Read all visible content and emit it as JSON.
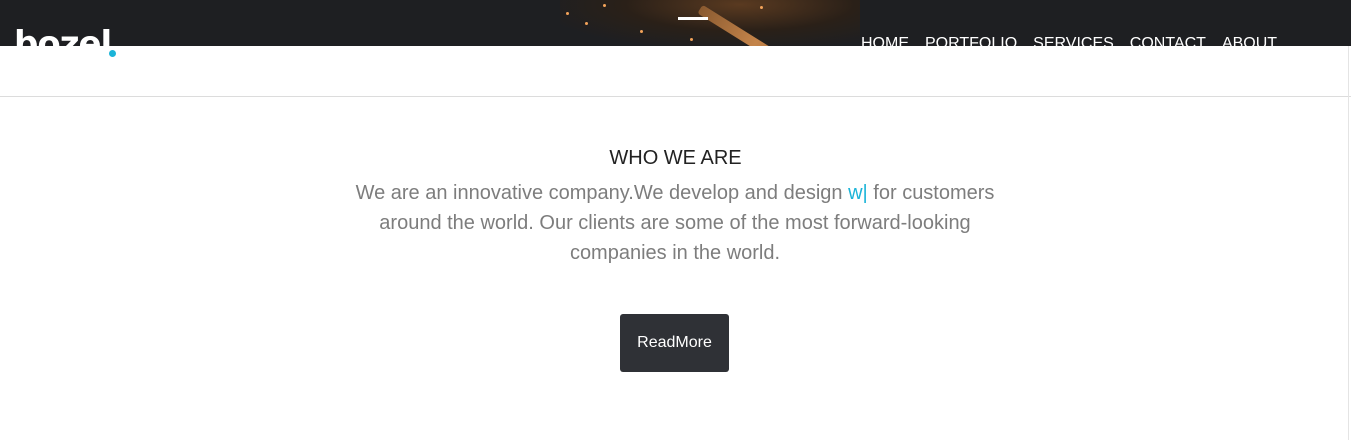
{
  "header": {
    "logo_text": "bozel",
    "nav": [
      {
        "label": "HOME"
      },
      {
        "label": "PORTFOLIO"
      },
      {
        "label": "SERVICES"
      },
      {
        "label": "CONTACT"
      },
      {
        "label": "ABOUT"
      }
    ]
  },
  "about": {
    "title": "WHO WE ARE",
    "text_before": "We are an innovative company.We develop and design ",
    "typed_text": "w|",
    "text_after": " for customers around the world. Our clients are some of the most forward-looking companies in the world.",
    "button_label": "ReadMore"
  },
  "colors": {
    "accent": "#1bb4d8",
    "header_bg": "#1e1f22",
    "button_bg": "#2f3136",
    "body_text": "#7d7d7d",
    "title_text": "#222222"
  }
}
